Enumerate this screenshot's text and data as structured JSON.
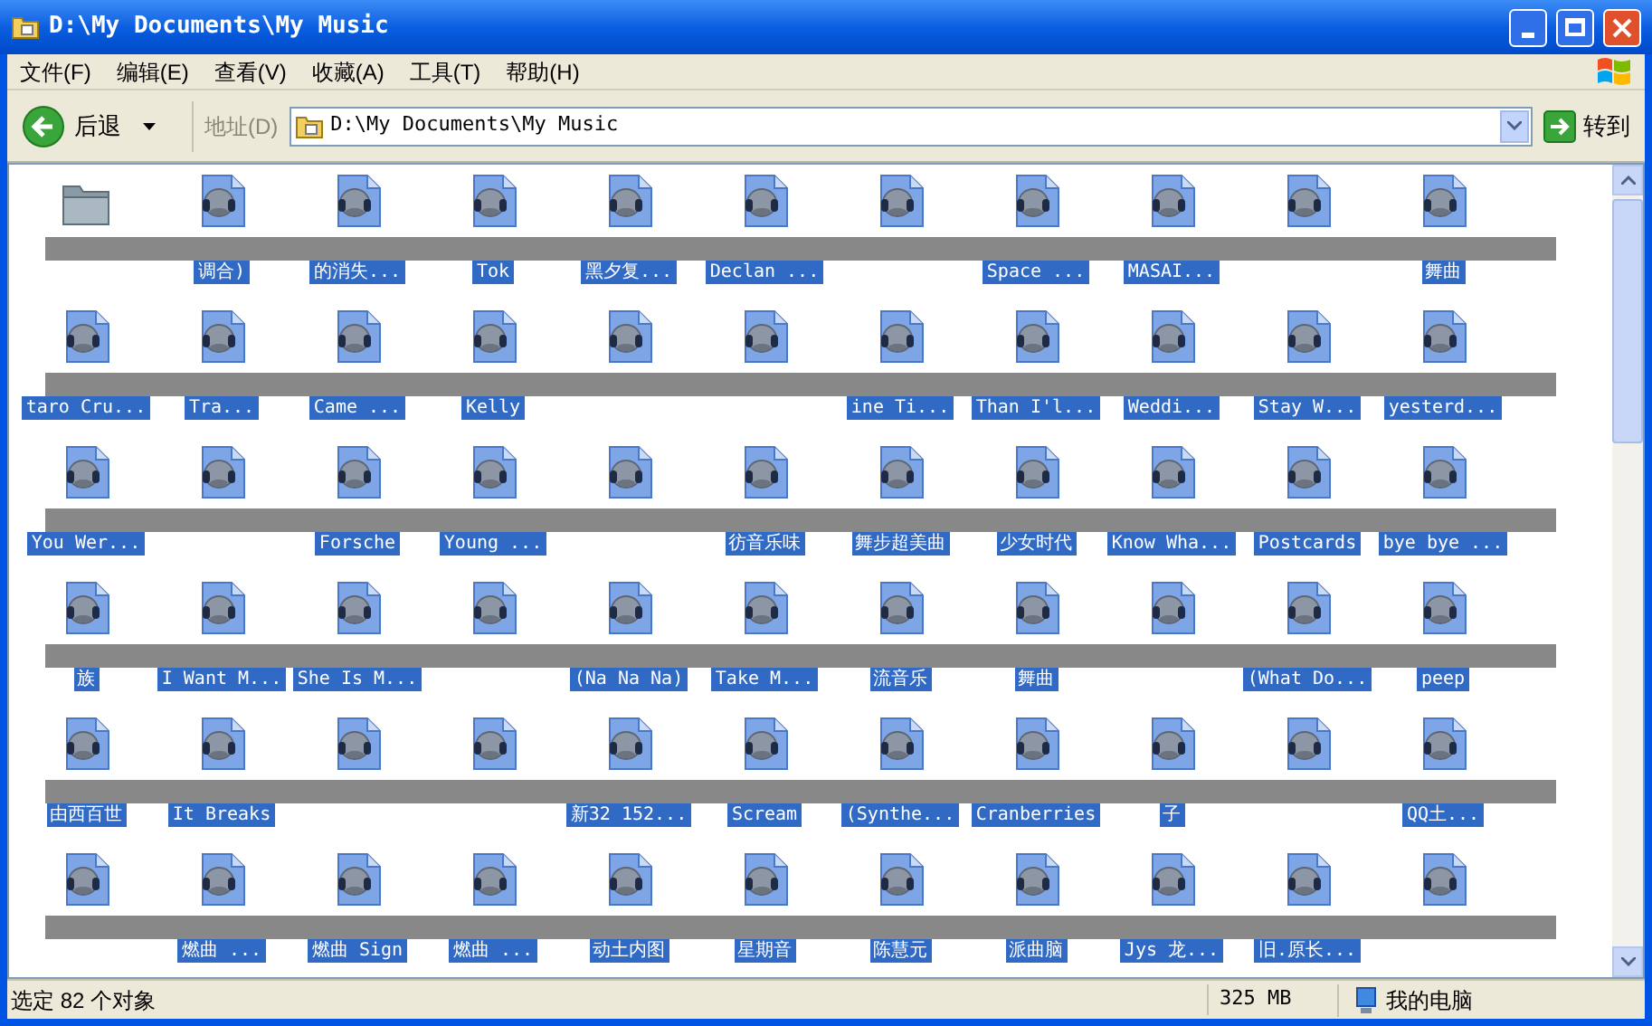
{
  "window": {
    "title": "D:\\My Documents\\My Music"
  },
  "menu": [
    "文件(F)",
    "编辑(E)",
    "查看(V)",
    "收藏(A)",
    "工具(T)",
    "帮助(H)"
  ],
  "toolbar": {
    "back": "后退",
    "address_label": "地址(D)",
    "address": "D:\\My Documents\\My Music",
    "go": "转到"
  },
  "rows": [
    {
      "items": [
        {
          "kind": "folder"
        },
        {
          "kind": "audio",
          "label": "调合)"
        },
        {
          "kind": "audio",
          "label": "的消失..."
        },
        {
          "kind": "audio",
          "label": "Tok"
        },
        {
          "kind": "audio",
          "label": "黑夕复..."
        },
        {
          "kind": "audio",
          "label": "Declan ..."
        },
        {
          "kind": "audio"
        },
        {
          "kind": "audio",
          "label": "Space ..."
        },
        {
          "kind": "audio",
          "label": "MASAI..."
        },
        {
          "kind": "audio"
        },
        {
          "kind": "audio",
          "label": "舞曲"
        }
      ]
    },
    {
      "items": [
        {
          "kind": "audio",
          "label": "taro Cru..."
        },
        {
          "kind": "audio",
          "label": "Tra..."
        },
        {
          "kind": "audio",
          "label": "Came ..."
        },
        {
          "kind": "audio",
          "label": "Kelly"
        },
        {
          "kind": "audio"
        },
        {
          "kind": "audio"
        },
        {
          "kind": "audio",
          "label": "ine Ti..."
        },
        {
          "kind": "audio",
          "label": "Than I'l..."
        },
        {
          "kind": "audio",
          "label": "Weddi..."
        },
        {
          "kind": "audio",
          "label": "Stay W..."
        },
        {
          "kind": "audio",
          "label": "yesterd..."
        }
      ]
    },
    {
      "items": [
        {
          "kind": "audio",
          "label": "You Wer..."
        },
        {
          "kind": "audio"
        },
        {
          "kind": "audio",
          "label": "Forsche"
        },
        {
          "kind": "audio",
          "label": "Young ..."
        },
        {
          "kind": "audio"
        },
        {
          "kind": "audio",
          "label": "彷音乐味"
        },
        {
          "kind": "audio",
          "label": "舞步超美曲"
        },
        {
          "kind": "audio",
          "label": "少女时代"
        },
        {
          "kind": "audio",
          "label": "Know Wha..."
        },
        {
          "kind": "audio",
          "label": "Postcards"
        },
        {
          "kind": "audio",
          "label": "bye bye ..."
        }
      ]
    },
    {
      "items": [
        {
          "kind": "audio",
          "label": "族"
        },
        {
          "kind": "audio",
          "label": "I Want M..."
        },
        {
          "kind": "audio",
          "label": "She Is M..."
        },
        {
          "kind": "audio"
        },
        {
          "kind": "audio",
          "label": "(Na Na Na)"
        },
        {
          "kind": "audio",
          "label": "Take M..."
        },
        {
          "kind": "audio",
          "label": "流音乐"
        },
        {
          "kind": "audio",
          "label": "舞曲"
        },
        {
          "kind": "audio"
        },
        {
          "kind": "audio",
          "label": "(What Do..."
        },
        {
          "kind": "audio",
          "label": "peep"
        }
      ]
    },
    {
      "items": [
        {
          "kind": "audio",
          "label": "由西百世"
        },
        {
          "kind": "audio",
          "label": "It Breaks"
        },
        {
          "kind": "audio"
        },
        {
          "kind": "audio"
        },
        {
          "kind": "audio",
          "label": "新32 152..."
        },
        {
          "kind": "audio",
          "label": "Scream"
        },
        {
          "kind": "audio",
          "label": "(Synthe..."
        },
        {
          "kind": "audio",
          "label": "Cranberries"
        },
        {
          "kind": "audio",
          "label": "子"
        },
        {
          "kind": "audio"
        },
        {
          "kind": "audio",
          "label": "QQ土..."
        }
      ]
    },
    {
      "items": [
        {
          "kind": "audio"
        },
        {
          "kind": "audio",
          "label": "燃曲 ..."
        },
        {
          "kind": "audio",
          "label": "燃曲 Sign"
        },
        {
          "kind": "audio",
          "label": "燃曲 ..."
        },
        {
          "kind": "audio",
          "label": "动土内图"
        },
        {
          "kind": "audio",
          "label": "星期音"
        },
        {
          "kind": "audio",
          "label": "陈慧元"
        },
        {
          "kind": "audio",
          "label": "派曲脑"
        },
        {
          "kind": "audio",
          "label": "Jys 龙..."
        },
        {
          "kind": "audio",
          "label": "旧.原长..."
        },
        {
          "kind": "audio"
        }
      ]
    }
  ],
  "status_bar": {
    "selection": "选定 82 个对象",
    "size": "325 MB",
    "location": "我的电脑"
  }
}
